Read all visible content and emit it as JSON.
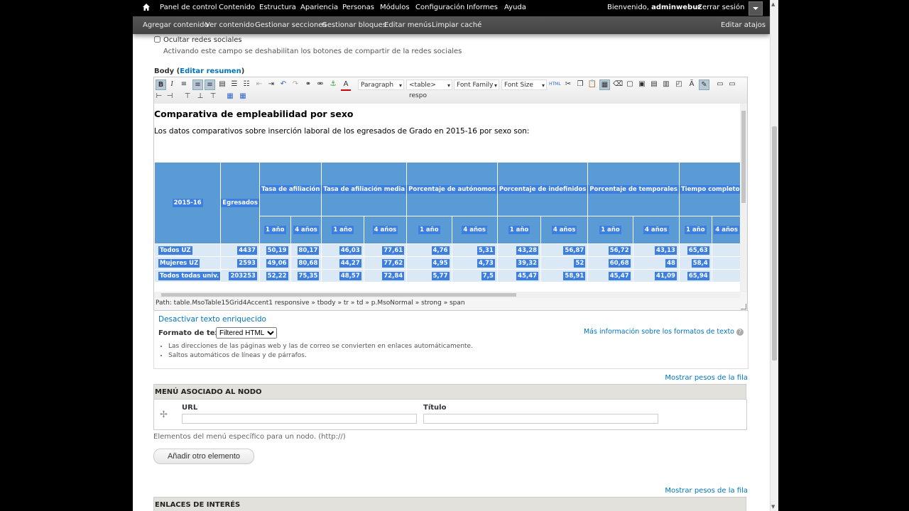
{
  "admin_bar": {
    "items": [
      "Panel de control",
      "Contenido",
      "Estructura",
      "Apariencia",
      "Personas",
      "Módulos",
      "Configuración",
      "Informes",
      "Ayuda"
    ],
    "welcome_prefix": "Bienvenido, ",
    "username": "adminwebuz",
    "logout": "Cerrar sesión"
  },
  "shortcuts_bar": {
    "items": [
      "Agregar contenido",
      "Ver contenido",
      "Gestionar secciones",
      "Gestionar bloques",
      "Editar menús",
      "Limpiar caché"
    ],
    "edit": "Editar atajos"
  },
  "social": {
    "checkbox_label": "Ocultar redes sociales",
    "description": "Activando este campo se deshabilitan los botones de compartir de la redes sociales"
  },
  "body_field": {
    "label": "Body",
    "summary_link": "Editar resumen",
    "open_paren": "(",
    "close_paren": ")"
  },
  "toolbar": {
    "format_select": "Paragraph",
    "table_select": "<table> respo",
    "font_family": "Font Family",
    "font_size": "Font Size",
    "html_label": "HTML"
  },
  "editor_content": {
    "heading": "Comparativa de empleabilidad por sexo",
    "paragraph": "Los datos comparativos sobre inserción laboral de los egresados de Grado en 2015-16 por sexo son:",
    "table": {
      "year_header": "2015-16",
      "egresados_header": "Egresados",
      "group_headers": [
        "Tasa de afiliación",
        "Tasa de afiliación media",
        "Porcentaje de autónomos",
        "Porcentaje de indefinidos",
        "Porcentaje de temporales",
        "Tiempo completo"
      ],
      "sub_headers": [
        "1 año",
        "4 años"
      ],
      "rows": [
        {
          "label": "Todos UZ",
          "values": [
            "4437",
            "50,19",
            "80,17",
            "46,03",
            "77,61",
            "4,76",
            "5,31",
            "43,28",
            "56,87",
            "56,72",
            "43,13",
            "65,63"
          ]
        },
        {
          "label": "Mujeres UZ",
          "values": [
            "2593",
            "49,06",
            "80,68",
            "44,27",
            "77,62",
            "4,95",
            "4,73",
            "39,32",
            "52",
            "60,68",
            "48",
            "58,4"
          ]
        },
        {
          "label": "Todos todas univ.",
          "values": [
            "203253",
            "52,22",
            "75,35",
            "48,57",
            "72,84",
            "5,77",
            "7,5",
            "45,47",
            "58,91",
            "45,47",
            "41,09",
            "65,94"
          ]
        }
      ]
    }
  },
  "path_bar": "Path: table.MsoTable15Grid4Accent1 responsive » tbody » tr » td » p.MsoNormal » strong » span",
  "format": {
    "deactivate": "Desactivar texto enriquecido",
    "label": "Formato de texto",
    "selected": "Filtered HTML",
    "more_info": "Más información sobre los formatos de texto",
    "tips": [
      "Las direcciones de las páginas web y las de correo se convierten en enlaces automáticamente.",
      "Saltos automáticos de líneas y de párrafos."
    ]
  },
  "show_weights": "Mostrar pesos de la fila",
  "menu_section": {
    "title": "MENÚ ASOCIADO AL NODO",
    "url_label": "URL",
    "title_label": "Título",
    "description": "Elementos del menú específico para un nodo. (http://)",
    "add_button": "Añadir otro elemento"
  },
  "links_section": {
    "title": "ENLACES DE INTERÉS"
  }
}
